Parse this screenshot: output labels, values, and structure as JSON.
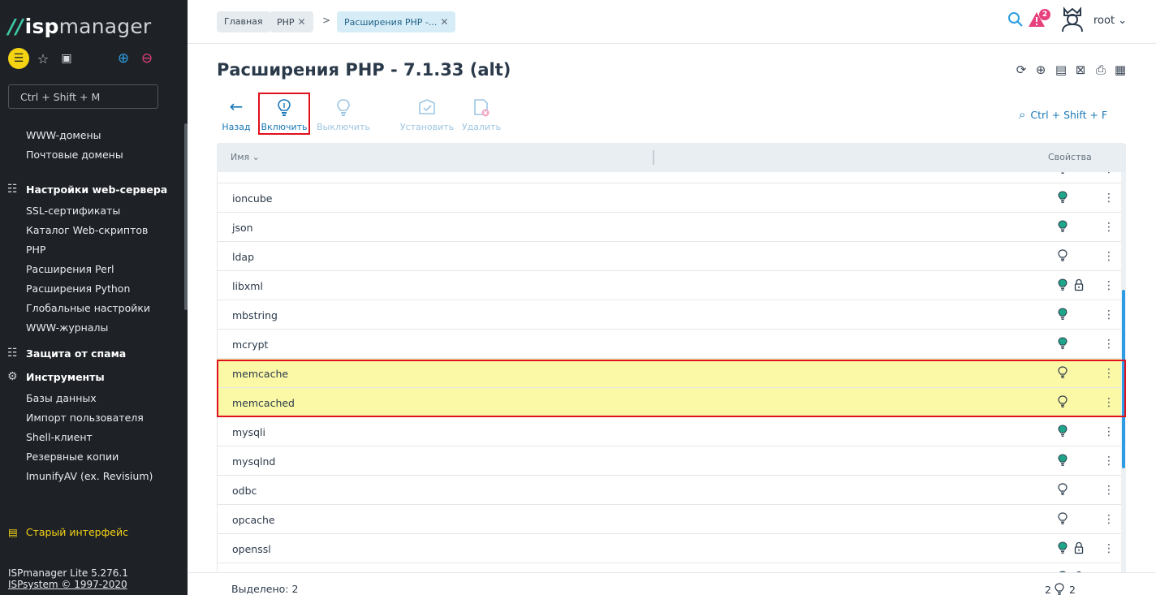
{
  "sidebar": {
    "logo": {
      "mark": "//",
      "isp": "isp",
      "manager": "manager"
    },
    "search_placeholder": "Ctrl + Shift + M",
    "items_top": [
      "WWW-домены",
      "Почтовые домены"
    ],
    "groups": [
      {
        "title": "Настройки web-сервера",
        "icon": "sliders-icon",
        "items": [
          "SSL-сертификаты",
          "Каталог Web-скриптов",
          "PHP",
          "Расширения Perl",
          "Расширения Python",
          "Глобальные настройки",
          "WWW-журналы"
        ]
      },
      {
        "title": "Защита от спама",
        "icon": "sliders-icon",
        "items": []
      },
      {
        "title": "Инструменты",
        "icon": "gear-icon",
        "items": [
          "Базы данных",
          "Импорт пользователя",
          "Shell-клиент",
          "Резервные копии",
          "ImunifyAV (ex. Revisium)"
        ]
      }
    ],
    "old_interface": "Старый интерфейс",
    "version": "ISPmanager Lite 5.276.1",
    "copyright": "ISPsystem © 1997-2020"
  },
  "header": {
    "breadcrumbs": [
      {
        "label": "Главная",
        "closable": false
      },
      {
        "label": "PHP",
        "closable": true
      },
      {
        "label": "Расширения PHP -...",
        "closable": true,
        "active": true
      }
    ],
    "separator": ">",
    "alert_count": "2",
    "user": "root"
  },
  "page": {
    "title": "Расширения PHP - 7.1.33 (alt)"
  },
  "toolbar": {
    "back": "Назад",
    "enable": "Включить",
    "disable": "Выключить",
    "install": "Установить",
    "delete": "Удалить",
    "search_shortcut": "Ctrl + Shift + F"
  },
  "table": {
    "columns": {
      "name": "Имя",
      "props": "Свойства"
    },
    "rows": [
      {
        "name": "",
        "status": "on",
        "locked": false,
        "partial": true
      },
      {
        "name": "ioncube",
        "status": "on",
        "locked": false
      },
      {
        "name": "json",
        "status": "on",
        "locked": false
      },
      {
        "name": "ldap",
        "status": "off",
        "locked": false
      },
      {
        "name": "libxml",
        "status": "on",
        "locked": true
      },
      {
        "name": "mbstring",
        "status": "on",
        "locked": false
      },
      {
        "name": "mcrypt",
        "status": "on",
        "locked": false
      },
      {
        "name": "memcache",
        "status": "off",
        "locked": false,
        "selected": true
      },
      {
        "name": "memcached",
        "status": "off",
        "locked": false,
        "selected": true
      },
      {
        "name": "mysqli",
        "status": "on",
        "locked": false
      },
      {
        "name": "mysqlnd",
        "status": "on",
        "locked": false
      },
      {
        "name": "odbc",
        "status": "off",
        "locked": false
      },
      {
        "name": "opcache",
        "status": "off",
        "locked": false
      },
      {
        "name": "openssl",
        "status": "on",
        "locked": true
      },
      {
        "name": "",
        "status": "on",
        "locked": true,
        "partial": true
      }
    ]
  },
  "footer": {
    "selected": "Выделено: 2",
    "count_left": "2",
    "count_right": "2"
  },
  "colors": {
    "accent": "#2c9de4",
    "sidebar_bg": "#1e2227",
    "bulb_on": "#1fa68a",
    "highlight": "#e0101c",
    "selected_row": "#fbf8a6",
    "brand_yellow": "#f4d313"
  }
}
